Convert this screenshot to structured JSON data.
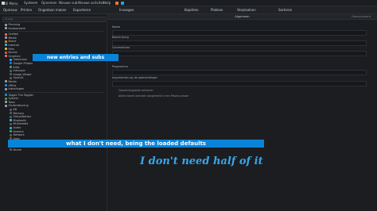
{
  "panel": {
    "items": [
      "KDE Menu",
      "Systeem",
      "Opnemen",
      "Nieuwe sub",
      "Nieuwe activiteit",
      "Help"
    ],
    "mid_items": [
      "Opnieuw",
      "Printen",
      "Ongedaan maken",
      "Exporteren",
      "Invoegen",
      "Kopiëren",
      "Plakken",
      "Verplaatsen",
      "Sorteren"
    ]
  },
  "left": {
    "search_placeholder": "Zoeken",
    "tree": [
      {
        "label": "Planning",
        "color": "#9aa0a6"
      },
      {
        "label": "Kantoorwerk",
        "color": "#9aa0a6"
      },
      {
        "label": "Grafiek",
        "color": "#ff6b5b"
      },
      {
        "label": "Media",
        "color": "#9aa0a6"
      },
      {
        "label": "Brave",
        "color": "#ff7a2f"
      },
      {
        "label": "Internet",
        "color": "#22c1e2"
      },
      {
        "label": "Files",
        "color": "#f0b429"
      },
      {
        "label": "Kennis",
        "color": "#e05555"
      },
      {
        "label": "Graphics",
        "color": "#f46a6a"
      },
      {
        "label": "Gwenview",
        "color": "#22a7f0",
        "indent": true
      },
      {
        "label": "Google Photos",
        "color": "#1a73e8",
        "indent": true
      },
      {
        "label": "Krita",
        "color": "#3ea64a",
        "indent": true
      },
      {
        "label": "Inkscape",
        "color": "#555b63",
        "indent": true
      },
      {
        "label": "Image Viewer",
        "color": "#555b63",
        "indent": true
      },
      {
        "label": "OpenGL",
        "color": "#555b63",
        "indent": true
      },
      {
        "label": "Media",
        "color": "#9aa0a6"
      },
      {
        "label": "Office",
        "color": "#2f80ed"
      },
      {
        "label": "Instellingen",
        "color": "#9aa0a6"
      },
      {
        "label": "Toggle The Toggler",
        "color": "#1b93e6"
      },
      {
        "label": "System",
        "color": "#4a9e45"
      },
      {
        "label": "Tools",
        "color": "#9aa0a6"
      },
      {
        "label": "Ondersteuning",
        "color": "#9aa0a6"
      },
      {
        "label": "KB",
        "color": "#555b63",
        "indent": true
      },
      {
        "label": "Memory",
        "color": "#555b63",
        "indent": true
      },
      {
        "label": "Virtualisation",
        "color": "#555b63",
        "indent": true
      },
      {
        "label": "Bluetooth",
        "color": "#22c1e2",
        "indent": true
      },
      {
        "label": "Multimedia",
        "color": "#555b63",
        "indent": true
      },
      {
        "label": "Audio",
        "color": "#3da1ff",
        "indent": true
      },
      {
        "label": "Kamera",
        "color": "#3ea64a",
        "indent": true
      },
      {
        "label": "Network",
        "color": "#555b63",
        "indent": true
      },
      {
        "label": "Apps",
        "color": "#555b63",
        "indent": true
      },
      {
        "label": "Scanner",
        "color": "#22c1e2",
        "indent": true
      },
      {
        "label": "Browser",
        "color": "#ff8a3d",
        "indent": true
      },
      {
        "label": "Kernel",
        "color": "#555b63",
        "indent": true
      }
    ]
  },
  "right": {
    "title": "Algemeen",
    "hint": "Geavanceerd",
    "fields": [
      "Naam",
      "Beschrijving",
      "Commentaar",
      "Programma",
      "Argumenten op de opdrachtregel"
    ],
    "notes": [
      "Opsommingsblok activeren",
      "Alleen tonen wanneer aangemeld in een Plasma-sessie"
    ]
  },
  "annotations": {
    "callout1": "new entries and subs",
    "callout2": "what I don't need, being the loaded defaults",
    "big": "I don't need half of it"
  }
}
